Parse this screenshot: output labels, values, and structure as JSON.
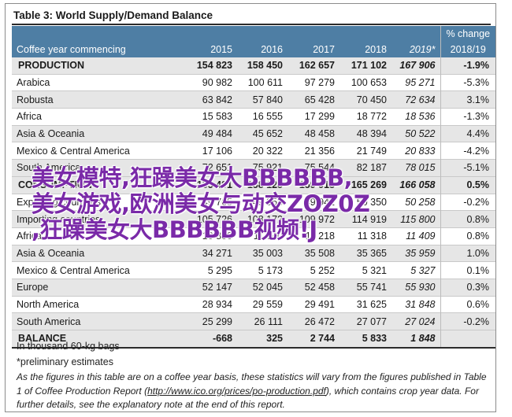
{
  "title": "Table 3: World Supply/Demand Balance",
  "header": {
    "col_label": "Coffee year commencing",
    "years": [
      "2015",
      "2016",
      "2017",
      "2018",
      "2019*"
    ],
    "change_line1": "% change",
    "change_line2": "2018/19"
  },
  "rows": [
    {
      "label": "PRODUCTION",
      "v2015": "154 823",
      "v2016": "158 450",
      "v2017": "162 657",
      "v2018": "171 102",
      "v2019": "167 906",
      "change": "-1.9%"
    },
    {
      "label": "Arabica",
      "v2015": "90 982",
      "v2016": "100 611",
      "v2017": "97 279",
      "v2018": "100 653",
      "v2019": "95 271",
      "change": "-5.3%"
    },
    {
      "label": "Robusta",
      "v2015": "63 842",
      "v2016": "57 840",
      "v2017": "65 428",
      "v2018": "70 450",
      "v2019": "72 634",
      "change": "3.1%"
    },
    {
      "label": "Africa",
      "v2015": "15 583",
      "v2016": "16 555",
      "v2017": "17 299",
      "v2018": "18 772",
      "v2019": "18 536",
      "change": "-1.3%"
    },
    {
      "label": "Asia & Oceania",
      "v2015": "49 484",
      "v2016": "45 652",
      "v2017": "48 458",
      "v2018": "48 394",
      "v2019": "50 522",
      "change": "4.4%"
    },
    {
      "label": "Mexico & Central America",
      "v2015": "17 106",
      "v2016": "20 322",
      "v2017": "21 356",
      "v2018": "21 749",
      "v2019": "20 833",
      "change": "-4.2%"
    },
    {
      "label": "South America",
      "v2015": "72 651",
      "v2016": "75 921",
      "v2017": "75 544",
      "v2018": "82 187",
      "v2019": "78 015",
      "change": "-5.1%"
    },
    {
      "label": "CONSUMPTION",
      "v2015": "155 491",
      "v2016": "158 125",
      "v2017": "159 913",
      "v2018": "165 269",
      "v2019": "166 058",
      "change": "0.5%"
    },
    {
      "label": "Exporting countries",
      "v2015": "49 765",
      "v2016": "49 953",
      "v2017": "49 941",
      "v2018": "50 350",
      "v2019": "50 258",
      "change": "-0.2%"
    },
    {
      "label": "Importing countries",
      "v2015": "105 726",
      "v2016": "108 172",
      "v2017": "109 972",
      "v2018": "114 919",
      "v2019": "115 800",
      "change": "0.8%"
    },
    {
      "label": "Africa",
      "v2015": "10 800",
      "v2016": "11 040",
      "v2017": "11 218",
      "v2018": "11 318",
      "v2019": "11 409",
      "change": "0.8%"
    },
    {
      "label": "Asia & Oceania",
      "v2015": "34 271",
      "v2016": "35 003",
      "v2017": "35 508",
      "v2018": "35 365",
      "v2019": "35 959",
      "change": "1.0%"
    },
    {
      "label": "Mexico & Central America",
      "v2015": "5 295",
      "v2016": "5 173",
      "v2017": "5 252",
      "v2018": "5 321",
      "v2019": "5 327",
      "change": "0.1%"
    },
    {
      "label": "Europe",
      "v2015": "52 147",
      "v2016": "52 045",
      "v2017": "52 458",
      "v2018": "55 741",
      "v2019": "55 930",
      "change": "0.3%"
    },
    {
      "label": "North America",
      "v2015": "28 934",
      "v2016": "29 559",
      "v2017": "29 491",
      "v2018": "31 625",
      "v2019": "31 848",
      "change": "0.6%"
    },
    {
      "label": "South America",
      "v2015": "25 299",
      "v2016": "26 111",
      "v2017": "26 472",
      "v2018": "27 077",
      "v2019": "27 024",
      "change": "-0.2%"
    },
    {
      "label": "BALANCE",
      "v2015": "-668",
      "v2016": "325",
      "v2017": "2 744",
      "v2018": "5 833",
      "v2019": "1 848",
      "change": ""
    }
  ],
  "notes": {
    "unit": "In thousand 60-kg bags",
    "prelim": "*preliminary estimates"
  },
  "footnote": {
    "part1": "As the figures in this table are on a coffee year basis, these statistics will vary from the figures published in Table 1 of Coffee Production Report (",
    "link": "http://www.ico.org/prices/po-production.pdf",
    "part2": "), which contains crop year data. For further details, see the explanatory note at the end of this report."
  },
  "overlay": {
    "line1": "美女模特,狂躁美女大BBBBBB,",
    "line2": "美女游戏,欧洲美女与动交ZOZ0Z",
    ",line3": "",
    "line3": ",狂躁美女大BBBBBB视频!J"
  },
  "colors": {
    "header_bg": "#4e7ea4",
    "shaded_row": "#e6e6e6",
    "overlay_text": "#7a2aa8"
  }
}
